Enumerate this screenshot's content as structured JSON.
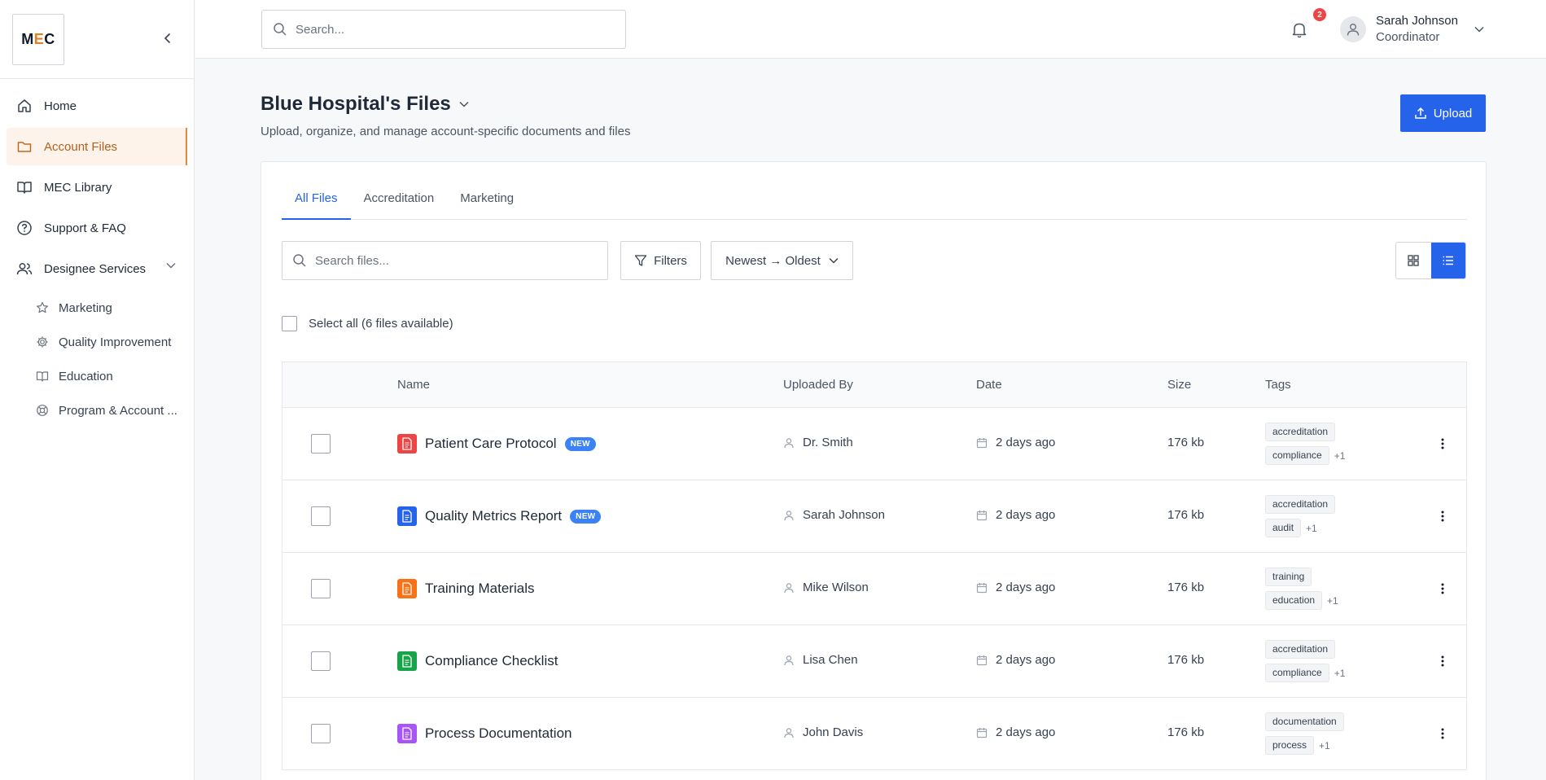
{
  "brand": {
    "logo_m": "M",
    "logo_e": "E",
    "logo_c": "C"
  },
  "sidebar": {
    "items": [
      {
        "label": "Home",
        "icon": "home-icon"
      },
      {
        "label": "Account Files",
        "icon": "folder-icon",
        "active": true
      },
      {
        "label": "MEC Library",
        "icon": "book-icon"
      },
      {
        "label": "Support & FAQ",
        "icon": "help-circle-icon"
      },
      {
        "label": "Designee Services",
        "icon": "users-icon",
        "expanded": true
      }
    ],
    "sub_items": [
      {
        "label": "Marketing",
        "icon": "star-icon"
      },
      {
        "label": "Quality Improvement",
        "icon": "gear-icon"
      },
      {
        "label": "Education",
        "icon": "book-icon"
      },
      {
        "label": "Program & Account ...",
        "icon": "lifebuoy-icon"
      }
    ]
  },
  "topbar": {
    "search_placeholder": "Search...",
    "notification_count": "2",
    "user_name": "Sarah Johnson",
    "user_role": "Coordinator"
  },
  "header": {
    "title": "Blue Hospital's Files",
    "subtitle": "Upload, organize, and manage account-specific documents and files",
    "upload_label": "Upload"
  },
  "tabs": [
    "All Files",
    "Accreditation",
    "Marketing"
  ],
  "toolbar": {
    "search_placeholder": "Search files...",
    "filters_label": "Filters",
    "sort_label": "Newest → Oldest",
    "select_all_label": "Select all (6 files available)"
  },
  "table": {
    "headers": {
      "name": "Name",
      "uploaded_by": "Uploaded By",
      "date": "Date",
      "size": "Size",
      "tags": "Tags"
    },
    "rows": [
      {
        "name": "Patient Care Protocol",
        "badge": "NEW",
        "icon_color": "#ef4444",
        "uploaded_by": "Dr. Smith",
        "date": "2 days ago",
        "size": "176 kb",
        "tag1": "accreditation",
        "tag2": "compliance",
        "more": "+1"
      },
      {
        "name": "Quality Metrics Report",
        "badge": "NEW",
        "icon_color": "#2563eb",
        "uploaded_by": "Sarah Johnson",
        "date": "2 days ago",
        "size": "176 kb",
        "tag1": "accreditation",
        "tag2": "audit",
        "more": "+1"
      },
      {
        "name": "Training Materials",
        "badge": "",
        "icon_color": "#f97316",
        "uploaded_by": "Mike Wilson",
        "date": "2 days ago",
        "size": "176 kb",
        "tag1": "training",
        "tag2": "education",
        "more": "+1"
      },
      {
        "name": "Compliance Checklist",
        "badge": "",
        "icon_color": "#16a34a",
        "uploaded_by": "Lisa Chen",
        "date": "2 days ago",
        "size": "176 kb",
        "tag1": "accreditation",
        "tag2": "compliance",
        "more": "+1"
      },
      {
        "name": "Process Documentation",
        "badge": "",
        "icon_color": "#a855f7",
        "uploaded_by": "John Davis",
        "date": "2 days ago",
        "size": "176 kb",
        "tag1": "documentation",
        "tag2": "process",
        "more": "+1"
      }
    ]
  },
  "colors": {
    "accent": "#2563eb",
    "active_nav": "#b45f1c",
    "badge_red": "#ef4444"
  }
}
